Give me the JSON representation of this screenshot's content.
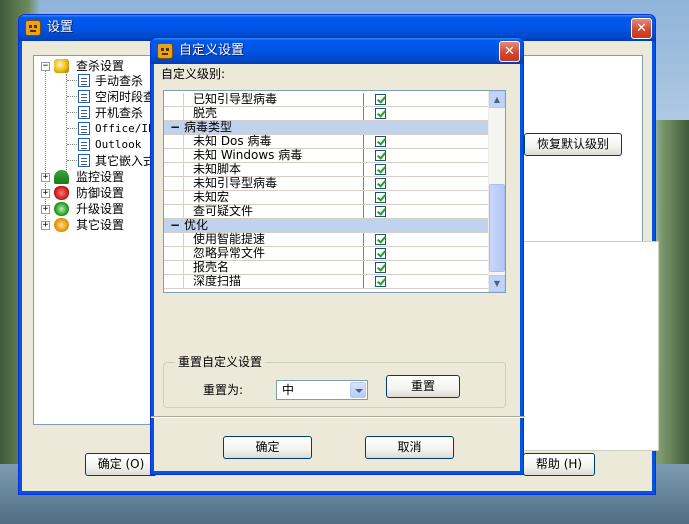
{
  "main_window": {
    "title": "设置",
    "tree": {
      "root_label": "查杀设置",
      "children": [
        "手动查杀",
        "空闲时段查",
        "开机查杀",
        "Office/IE",
        "Outlook",
        "其它嵌入式"
      ],
      "siblings": [
        "监控设置",
        "防御设置",
        "升级设置",
        "其它设置"
      ]
    },
    "restore_button": "恢复默认级别",
    "ok_button": "确定 (O)",
    "help_button": "帮助 (H)"
  },
  "dialog": {
    "title": "自定义设置",
    "section_label": "自定义级别:",
    "rows": [
      {
        "type": "item",
        "label": "已知引导型病毒",
        "checked": true
      },
      {
        "type": "item",
        "label": "脱壳",
        "checked": true
      },
      {
        "type": "group",
        "label": "病毒类型"
      },
      {
        "type": "item",
        "label": "未知 Dos 病毒",
        "checked": true
      },
      {
        "type": "item",
        "label": "未知 Windows 病毒",
        "checked": true
      },
      {
        "type": "item",
        "label": "未知脚本",
        "checked": true
      },
      {
        "type": "item",
        "label": "未知引导型病毒",
        "checked": true
      },
      {
        "type": "item",
        "label": "未知宏",
        "checked": true
      },
      {
        "type": "item",
        "label": "查可疑文件",
        "checked": true
      },
      {
        "type": "group",
        "label": "优化"
      },
      {
        "type": "item",
        "label": "使用智能提速",
        "checked": true
      },
      {
        "type": "item",
        "label": "忽略异常文件",
        "checked": true
      },
      {
        "type": "item",
        "label": "报壳名",
        "checked": true
      },
      {
        "type": "item",
        "label": "深度扫描",
        "checked": true
      }
    ],
    "reset_group": {
      "label": "重置自定义设置",
      "reset_to_label": "重置为:",
      "selected_value": "中",
      "reset_button": "重置"
    },
    "ok_button": "确定",
    "cancel_button": "取消"
  },
  "icons": {
    "close": "close-icon",
    "app": "app-icon",
    "expand": "expand-icon",
    "collapse": "collapse-icon",
    "check": "check-icon",
    "dropdown": "chevron-down-icon"
  },
  "colors": {
    "titlebar": "#0055e5",
    "window_face": "#ece9d8",
    "group_header": "#c1d2ee",
    "check_mark": "#21a121"
  }
}
